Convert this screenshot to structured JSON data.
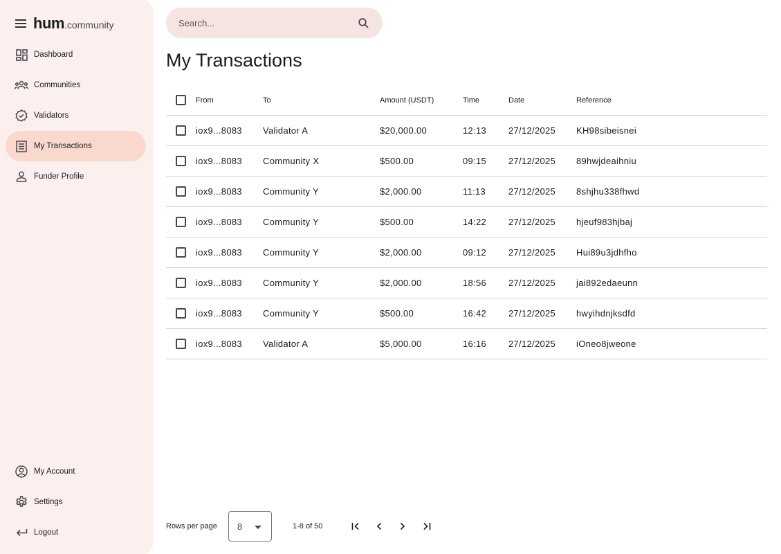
{
  "brand": {
    "name": "hum",
    "suffix": ".community"
  },
  "sidebar": {
    "items": [
      {
        "label": "Dashboard",
        "icon": "dashboard-icon",
        "active": false
      },
      {
        "label": "Communities",
        "icon": "groups-icon",
        "active": false
      },
      {
        "label": "Validators",
        "icon": "verified-badge-icon",
        "active": false
      },
      {
        "label": "My Transactions",
        "icon": "receipt-list-icon",
        "active": true
      },
      {
        "label": "Funder Profile",
        "icon": "person-icon",
        "active": false
      }
    ],
    "bottom_items": [
      {
        "label": "My Account",
        "icon": "account-circle-icon"
      },
      {
        "label": "Settings",
        "icon": "gear-icon"
      },
      {
        "label": "Logout",
        "icon": "logout-arrow-icon"
      }
    ]
  },
  "search": {
    "placeholder": "Search...",
    "value": ""
  },
  "page": {
    "title": "My Transactions"
  },
  "table": {
    "headers": {
      "from": "From",
      "to": "To",
      "amount": "Amount (USDT)",
      "time": "Time",
      "date": "Date",
      "reference": "Reference"
    },
    "rows": [
      {
        "from": "iox9...8083",
        "to": "Validator A",
        "amount": "$20,000.00",
        "time": "12:13",
        "date": "27/12/2025",
        "reference": "KH98sibeisnei"
      },
      {
        "from": "iox9...8083",
        "to": "Community X",
        "amount": "$500.00",
        "time": "09:15",
        "date": "27/12/2025",
        "reference": "89hwjdeaihniu"
      },
      {
        "from": "iox9...8083",
        "to": "Community Y",
        "amount": "$2,000.00",
        "time": "11:13",
        "date": "27/12/2025",
        "reference": "8shjhu338fhwd"
      },
      {
        "from": "iox9...8083",
        "to": "Community Y",
        "amount": "$500.00",
        "time": "14:22",
        "date": "27/12/2025",
        "reference": "hjeuf983hjbaj"
      },
      {
        "from": "iox9...8083",
        "to": "Community Y",
        "amount": "$2,000.00",
        "time": "09:12",
        "date": "27/12/2025",
        "reference": "Hui89u3jdhfho"
      },
      {
        "from": "iox9...8083",
        "to": "Community Y",
        "amount": "$2,000.00",
        "time": "18:56",
        "date": "27/12/2025",
        "reference": "jai892edaeunn"
      },
      {
        "from": "iox9...8083",
        "to": "Community Y",
        "amount": "$500.00",
        "time": "16:42",
        "date": "27/12/2025",
        "reference": "hwyihdnjksdfd"
      },
      {
        "from": "iox9...8083",
        "to": "Validator A",
        "amount": "$5,000.00",
        "time": "16:16",
        "date": "27/12/2025",
        "reference": "iOneo8jweone"
      }
    ]
  },
  "pagination": {
    "rows_per_page_label": "Rows per page",
    "rows_per_page_value": "8",
    "range_label": "1-8 of 50"
  },
  "colors": {
    "sidebar_bg": "#fbf0ee",
    "active_nav_bg": "#f9d9ce",
    "search_bg": "#f4e5e2",
    "divider": "#d9d3d2"
  }
}
